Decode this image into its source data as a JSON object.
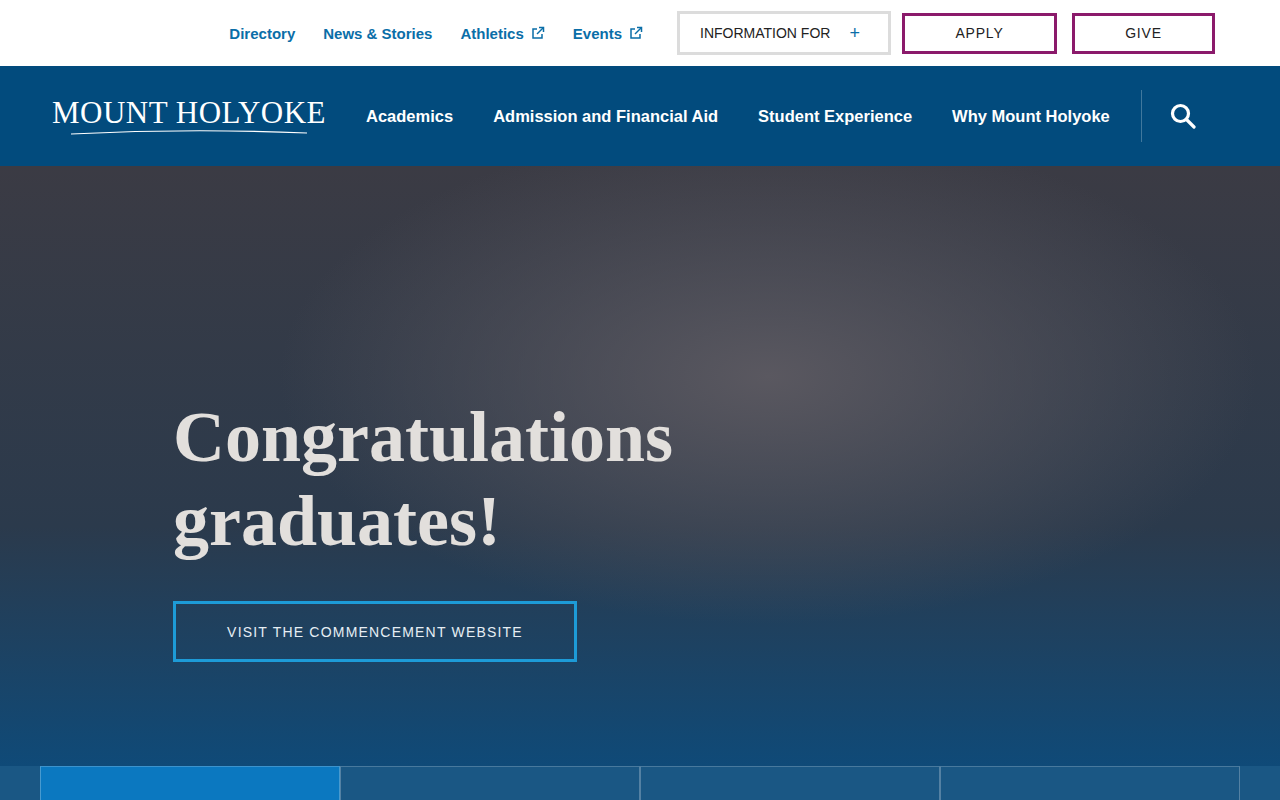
{
  "utility_bar": {
    "links": [
      {
        "label": "Directory",
        "external": false
      },
      {
        "label": "News & Stories",
        "external": false
      },
      {
        "label": "Athletics",
        "external": true
      },
      {
        "label": "Events",
        "external": true
      }
    ],
    "dropdown": {
      "label": "INFORMATION FOR",
      "symbol": "+",
      "expanded": false
    },
    "buttons": [
      "APPLY",
      "GIVE"
    ]
  },
  "main_nav": {
    "logo": "MOUNT HOLYOKE",
    "items": [
      "Academics",
      "Admission and Financial Aid",
      "Student Experience",
      "Why Mount Holyoke"
    ]
  },
  "hero": {
    "heading_lines": [
      "Congratulations",
      "graduates!"
    ],
    "cta": "VISIT THE COMMENCEMENT WEBSITE"
  },
  "tiles": [
    {
      "selected": true
    },
    {
      "selected": false
    },
    {
      "selected": false
    },
    {
      "selected": false
    }
  ]
}
